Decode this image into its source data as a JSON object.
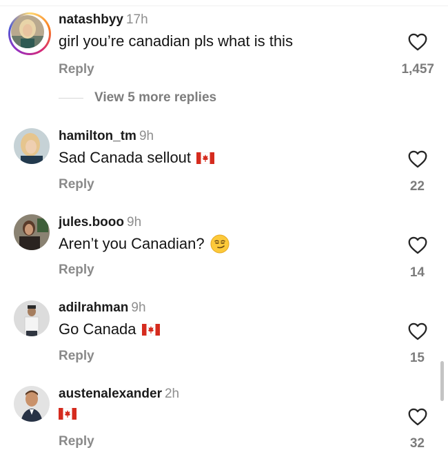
{
  "comments": [
    {
      "username": "natashbyy",
      "time": "17h",
      "text": "girl you’re canadian pls what is this",
      "emoji": "",
      "reply": "Reply",
      "likes": "1,457",
      "story_ring": true
    },
    {
      "username": "hamilton_tm",
      "time": "9h",
      "text": "Sad Canada sellout",
      "emoji": "canada-flag",
      "reply": "Reply",
      "likes": "22"
    },
    {
      "username": "jules.booo",
      "time": "9h",
      "text": "Aren’t you Canadian?",
      "emoji": "smirking-face",
      "reply": "Reply",
      "likes": "14"
    },
    {
      "username": "adilrahman",
      "time": "9h",
      "text": "Go Canada",
      "emoji": "canada-flag",
      "reply": "Reply",
      "likes": "15"
    },
    {
      "username": "austenalexander",
      "time": "2h",
      "text": "",
      "emoji": "canada-flag",
      "reply": "Reply",
      "likes": "32"
    }
  ],
  "view_more_replies": "View 5 more replies",
  "colors": {
    "heart_stroke": "#262626",
    "muted": "#8e8e8e",
    "flag_red": "#d52b1e"
  }
}
